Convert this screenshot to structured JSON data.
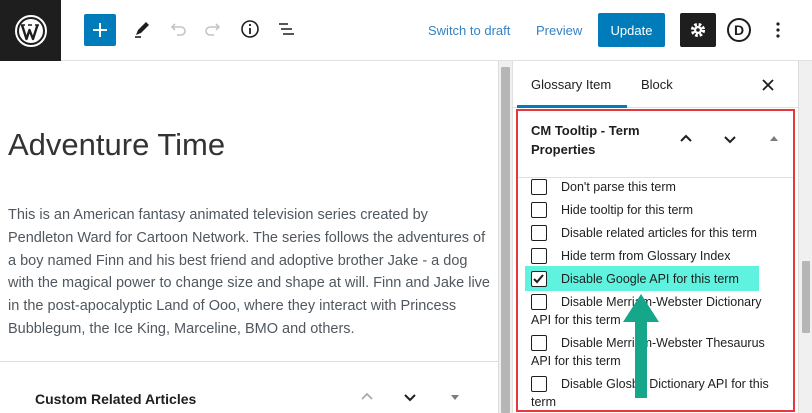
{
  "toolbar": {
    "switch_to_draft": "Switch to draft",
    "preview": "Preview",
    "update": "Update",
    "avatar_letter": "D"
  },
  "post": {
    "title": "Adventure Time",
    "body": "This is an American fantasy animated television series created by Pendleton Ward for Cartoon Network. The series follows the adventures of a boy named Finn and his best friend and adoptive brother Jake - a dog with the magical power to change size and shape at will. Finn and Jake live in the post-apocalyptic Land of Ooo, where they interact with Princess Bubblegum, the Ice King, Marceline, BMO and others."
  },
  "meta_box": {
    "title": "Custom Related Articles"
  },
  "sidebar": {
    "tabs": [
      {
        "label": "Glossary Item",
        "active": true
      },
      {
        "label": "Block",
        "active": false
      }
    ],
    "panel": {
      "title": "CM Tooltip - Term Properties",
      "options": [
        {
          "label": "Don't parse this term",
          "checked": false
        },
        {
          "label": "Hide tooltip for this term",
          "checked": false
        },
        {
          "label": "Disable related articles for this term",
          "checked": false
        },
        {
          "label": "Hide term from Glossary Index",
          "checked": false
        },
        {
          "label": "Disable Google API for this term",
          "checked": true
        },
        {
          "label": "Disable Merriam-Webster Dictionary",
          "label2": "API for this term",
          "checked": false
        },
        {
          "label": "Disable Merriam-Webster Thesaurus",
          "label2": "API for this term",
          "checked": false
        },
        {
          "label": "Disable Glosbe Dictionary API for this",
          "label2": "term",
          "checked": false
        }
      ]
    }
  },
  "colors": {
    "accent": "#007cba",
    "highlight": "#5ef2df",
    "annotation_border": "#e4383c",
    "arrow": "#16a68a"
  }
}
